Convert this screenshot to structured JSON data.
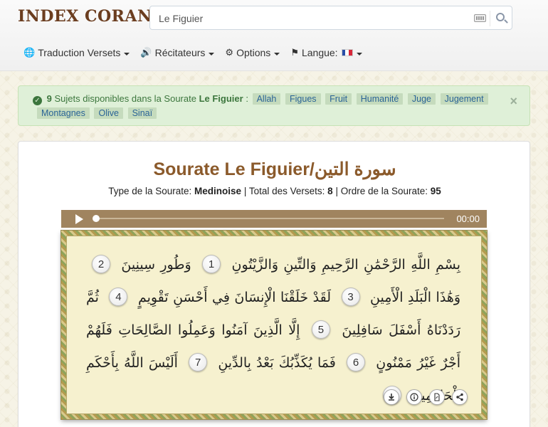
{
  "header": {
    "logo": "INDEX CORAN",
    "search_value": "Le Figuier"
  },
  "nav": {
    "items": [
      {
        "label": "Traduction Versets",
        "icon": "globe-icon"
      },
      {
        "label": "Récitateurs",
        "icon": "volume-icon"
      },
      {
        "label": "Options",
        "icon": "gear-icon"
      },
      {
        "label": "Langue:",
        "icon": "flag-icon"
      }
    ]
  },
  "alert": {
    "count": "9",
    "text_a": "Sujets disponibles dans la Sourate",
    "sourate": "Le Figuier",
    "colon": ":",
    "tags": [
      "Allah",
      "Figues",
      "Fruit",
      "Humanité",
      "Juge",
      "Jugement",
      "Montagnes",
      "Olive",
      "Sinaï"
    ],
    "close": "×"
  },
  "panel": {
    "title": "Sourate Le Figuier/سورة التين",
    "type_label": "Type de la Sourate:",
    "type_value": "Medinoise",
    "total_label": "| Total des Versets:",
    "total_value": "8",
    "order_label": "| Ordre de la Sourate:",
    "order_value": "95"
  },
  "player": {
    "time": "00:00",
    "progress": 0
  },
  "verses": [
    {
      "text": "بِسْمِ اللَّهِ الرَّحْمَٰنِ الرَّحِيمِ وَالتِّينِ وَالزَّيْتُونِ",
      "num": "1"
    },
    {
      "text": "وَطُورِ سِينِينَ",
      "num": "2"
    },
    {
      "text": "وَهَٰذَا الْبَلَدِ الْأَمِينِ",
      "num": "3"
    },
    {
      "text": "لَقَدْ خَلَقْنَا الْإِنسَانَ فِي أَحْسَنِ تَقْوِيمٍ",
      "num": "4"
    },
    {
      "text": "ثُمَّ رَدَدْنَاهُ أَسْفَلَ سَافِلِينَ",
      "num": "5"
    },
    {
      "text": "إِلَّا الَّذِينَ آمَنُوا وَعَمِلُوا الصَّالِحَاتِ فَلَهُمْ أَجْرٌ غَيْرُ مَمْنُونٍ",
      "num": "6"
    },
    {
      "text": "فَمَا يُكَذِّبُكَ بَعْدُ بِالدِّينِ",
      "num": "7"
    },
    {
      "text": "أَلَيْسَ اللَّهُ بِأَحْكَمِ الْحَاكِمِينَ",
      "num": "8"
    }
  ],
  "actions": [
    "download-icon",
    "info-icon",
    "pdf-icon",
    "share-icon"
  ],
  "colors": {
    "brand": "#8b5a2b",
    "alert_bg": "#dff0d8",
    "player": "#a0845f",
    "parchment": "#f6f1cf"
  }
}
